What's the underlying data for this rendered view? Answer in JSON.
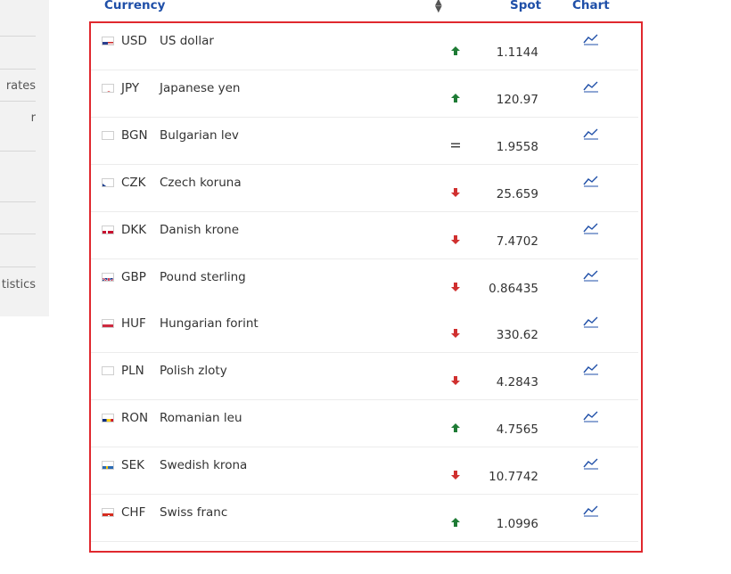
{
  "sidebar": {
    "items": [
      {
        "label": ""
      },
      {
        "label": ""
      },
      {
        "label": "rates"
      },
      {
        "label": "r"
      },
      {
        "label": ""
      },
      {
        "label": ""
      },
      {
        "label": ""
      },
      {
        "label": "tistics"
      }
    ]
  },
  "table": {
    "headers": {
      "currency": "Currency",
      "spot": "Spot",
      "chart": "Chart"
    },
    "rows": [
      {
        "code": "USD",
        "name": "US dollar",
        "trend": "up",
        "spot": "1.1144",
        "flag": "us-flag-icon"
      },
      {
        "code": "JPY",
        "name": "Japanese yen",
        "trend": "up",
        "spot": "120.97",
        "flag": "jp-flag-icon"
      },
      {
        "code": "BGN",
        "name": "Bulgarian lev",
        "trend": "same",
        "spot": "1.9558",
        "flag": "bg-flag-icon"
      },
      {
        "code": "CZK",
        "name": "Czech koruna",
        "trend": "down",
        "spot": "25.659",
        "flag": "cz-flag-icon"
      },
      {
        "code": "DKK",
        "name": "Danish krone",
        "trend": "down",
        "spot": "7.4702",
        "flag": "dk-flag-icon"
      },
      {
        "code": "GBP",
        "name": "Pound sterling",
        "trend": "down",
        "spot": "0.86435",
        "flag": "gb-flag-icon"
      },
      {
        "code": "HUF",
        "name": "Hungarian forint",
        "trend": "down",
        "spot": "330.62",
        "flag": "hu-flag-icon"
      },
      {
        "code": "PLN",
        "name": "Polish zloty",
        "trend": "down",
        "spot": "4.2843",
        "flag": "pl-flag-icon"
      },
      {
        "code": "RON",
        "name": "Romanian leu",
        "trend": "up",
        "spot": "4.7565",
        "flag": "ro-flag-icon"
      },
      {
        "code": "SEK",
        "name": "Swedish krona",
        "trend": "down",
        "spot": "10.7742",
        "flag": "se-flag-icon"
      },
      {
        "code": "CHF",
        "name": "Swiss franc",
        "trend": "up",
        "spot": "1.0996",
        "flag": "ch-flag-icon"
      }
    ]
  },
  "colors": {
    "accent": "#1f4fa8",
    "highlight_border": "#e0282e",
    "trend_up": "#1e7b35",
    "trend_down": "#d0302f"
  }
}
